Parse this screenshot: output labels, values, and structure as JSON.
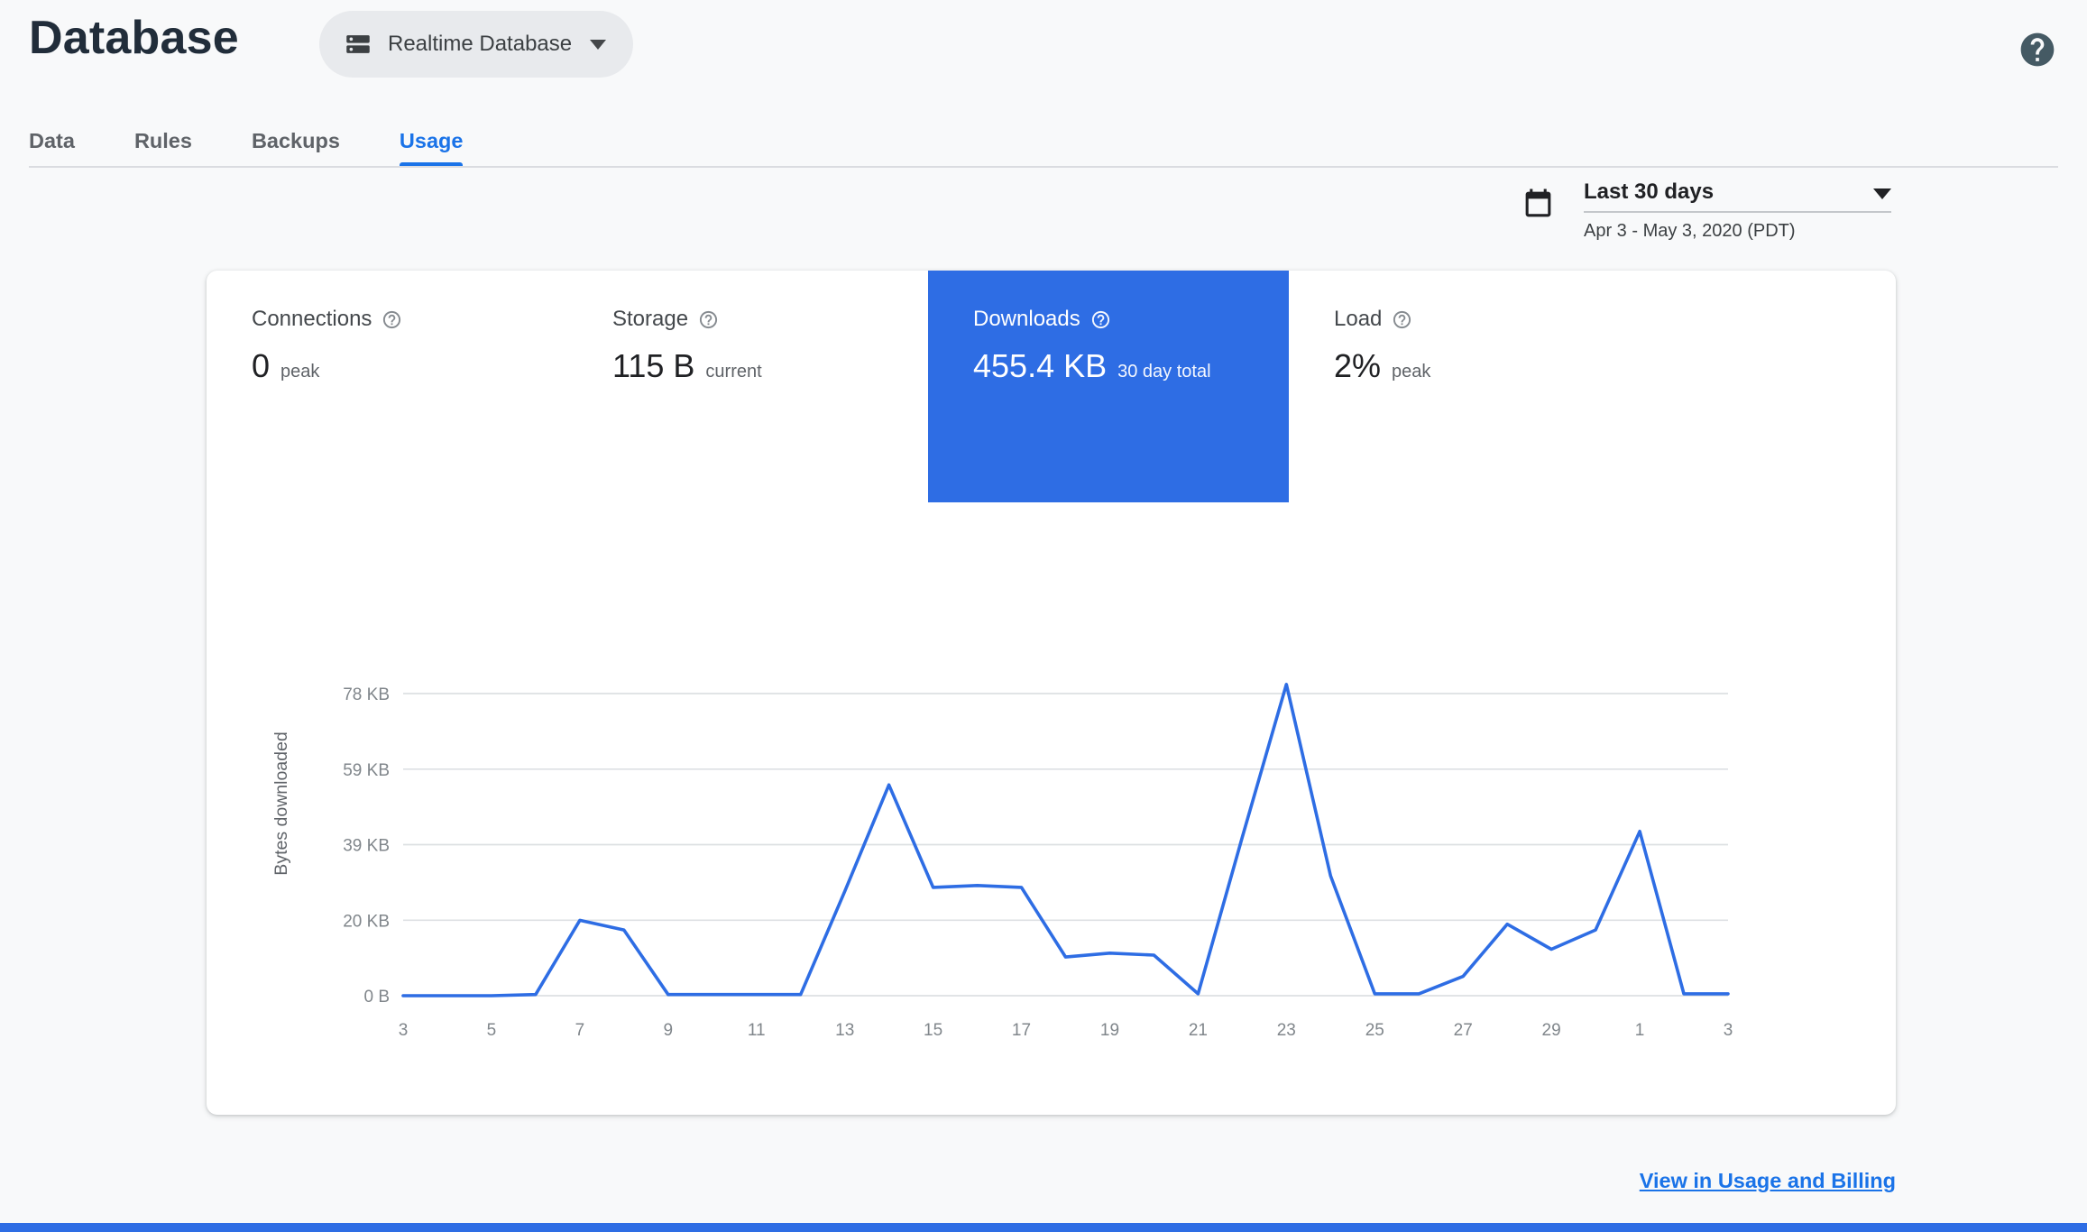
{
  "header": {
    "title": "Database",
    "database_selector": "Realtime Database"
  },
  "tabs": {
    "items": [
      {
        "label": "Data"
      },
      {
        "label": "Rules"
      },
      {
        "label": "Backups"
      },
      {
        "label": "Usage"
      }
    ],
    "active": "Usage"
  },
  "date_range": {
    "preset": "Last 30 days",
    "detail": "Apr 3 - May 3, 2020 (PDT)"
  },
  "metrics": [
    {
      "label": "Connections",
      "value": "0",
      "unit": "peak",
      "selected": false
    },
    {
      "label": "Storage",
      "value": "115 B",
      "unit": "current",
      "selected": false
    },
    {
      "label": "Downloads",
      "value": "455.4 KB",
      "unit": "30 day total",
      "selected": true
    },
    {
      "label": "Load",
      "value": "2%",
      "unit": "peak",
      "selected": false
    }
  ],
  "footer": {
    "link_label": "View in Usage and Billing"
  },
  "colors": {
    "accent": "#1a73e8",
    "selected_metric_bg": "#2e6de4",
    "chart_line": "#2e6de4",
    "help_icon": "#455a64",
    "page_bg": "#f8f9fa",
    "footer_bar": "#2e6de4"
  },
  "chart_data": {
    "type": "line",
    "title": "Downloads - 30 day total 455.4 KB",
    "ylabel": "Bytes downloaded",
    "xlabel": "",
    "legend": "none",
    "grid": true,
    "line_color": "#2e6de4",
    "ylim_kb": [
      0,
      83.5
    ],
    "y_ticks": [
      {
        "label": "0 B",
        "kb": 0
      },
      {
        "label": "20 KB",
        "kb": 19.53
      },
      {
        "label": "39 KB",
        "kb": 39.06
      },
      {
        "label": "59 KB",
        "kb": 58.59
      },
      {
        "label": "78 KB",
        "kb": 78.13
      }
    ],
    "x_tick_labels": [
      "3",
      "5",
      "7",
      "9",
      "11",
      "13",
      "15",
      "17",
      "19",
      "21",
      "23",
      "25",
      "27",
      "29",
      "1",
      "3"
    ],
    "x": [
      "Apr 3",
      "Apr 4",
      "Apr 5",
      "Apr 6",
      "Apr 7",
      "Apr 8",
      "Apr 9",
      "Apr 10",
      "Apr 11",
      "Apr 12",
      "Apr 13",
      "Apr 14",
      "Apr 15",
      "Apr 16",
      "Apr 17",
      "Apr 18",
      "Apr 19",
      "Apr 20",
      "Apr 21",
      "Apr 22",
      "Apr 23",
      "Apr 24",
      "Apr 25",
      "Apr 26",
      "Apr 27",
      "Apr 28",
      "Apr 29",
      "Apr 30",
      "May 1",
      "May 2",
      "May 3"
    ],
    "values_kb": [
      0,
      0,
      0,
      0.3,
      19.5,
      17,
      0.3,
      0.3,
      0.3,
      0.3,
      27,
      54.5,
      28,
      28.5,
      28,
      10,
      11,
      10.5,
      0.5,
      41,
      80.5,
      31,
      0.5,
      0.5,
      5,
      18.5,
      12,
      17,
      42.5,
      0.5,
      0.5
    ]
  }
}
